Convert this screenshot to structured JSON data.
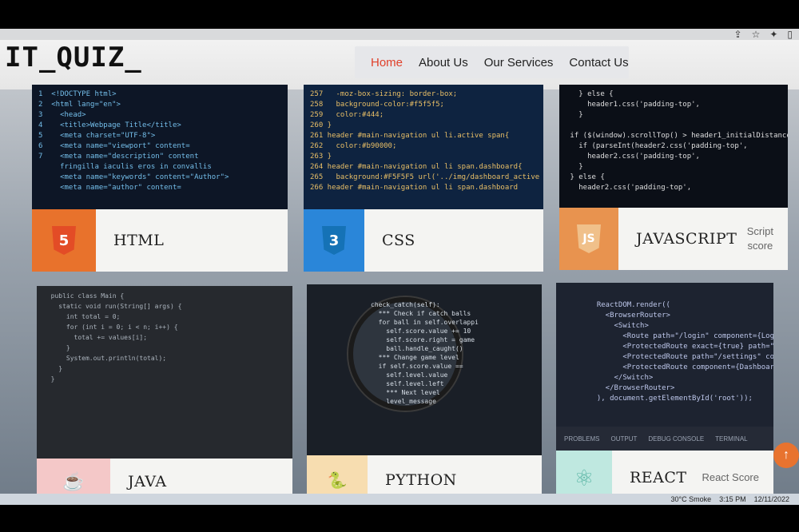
{
  "site": {
    "logo": "IT_QUIZ_"
  },
  "nav": [
    {
      "label": "Home",
      "active": true
    },
    {
      "label": "About Us",
      "active": false
    },
    {
      "label": "Our Services",
      "active": false
    },
    {
      "label": "Contact Us",
      "active": false
    }
  ],
  "cards": [
    {
      "title": "HTML",
      "icon": "html5-icon",
      "icon_text": "5",
      "badge_color": "#e8722c",
      "shield_color": "#e34c26",
      "score": ""
    },
    {
      "title": "CSS",
      "icon": "css3-icon",
      "icon_text": "3",
      "badge_color": "#2a86d9",
      "shield_color": "#1572b6",
      "score": ""
    },
    {
      "title": "JAVASCRIPT",
      "icon": "js-icon",
      "icon_text": "JS",
      "badge_color": "#e8934f",
      "shield_color": "#f0c08a",
      "score": "Script\nscore"
    },
    {
      "title": "JAVA",
      "icon": "java-cup-icon",
      "icon_text": "☕",
      "badge_color": "#f4c8c8",
      "shield_color": "",
      "score": ""
    },
    {
      "title": "PYTHON",
      "icon": "python-icon",
      "icon_text": "🐍",
      "badge_color": "#f7ddb0",
      "shield_color": "",
      "score": ""
    },
    {
      "title": "REACT",
      "icon": "react-atom-icon",
      "icon_text": "⚛",
      "badge_color": "#bfe8e0",
      "shield_color": "",
      "score": "React Score"
    }
  ],
  "code_snippets": {
    "html": "1  <!DOCTYPE html>\n2  <html lang=\"en\">\n3    <head>\n4    <title>Webpage Title</title>\n5    <meta charset=\"UTF-8\">\n6    <meta name=\"viewport\" content=\n7    <meta name=\"description\" content\n     fringilla iaculis eros in convallis\n     <meta name=\"keywords\" content=\"Author\">\n     <meta name=\"author\" content=",
    "css": "257   -moz-box-sizing: border-box;\n258   background-color:#f5f5f5;\n259   color:#444;\n260 }\n261 header #main-navigation ul li.active span{\n262   color:#b90000;\n263 }\n264 header #main-navigation ul li span.dashboard{\n265   background:#F5F5F5 url('../img/dashboard_active\n266 header #main-navigation ul li span.dashboard",
    "js": "   } else {\n     header1.css('padding-top',\n   }\n\n if ($(window).scrollTop() > header1_initialDistance\n   if (parseInt(header2.css('padding-top',\n     header2.css('padding-top',\n   }\n } else {\n   header2.css('padding-top',",
    "java": "  public class Main {\n    static void run(String[] args) {\n      int total = 0;\n      for (int i = 0; i < n; i++) {\n        total += values[i];\n      }\n      System.out.println(total);\n    }\n  }",
    "python": "check_catch(self):\n  *** Check if catch balls\n  for ball in self.overlappi\n    self.score.value += 10\n    self.score.right = game\n    ball.handle_caught()\n  *** Change game level\n  if self.score.value ==\n    self.level.value\n    self.level.left\n    *** Next level\n    level_message",
    "react": "  ReactDOM.render((\n    <BrowserRouter>\n      <Switch>\n        <Route path=\"/login\" component={Login}\n        <ProtectedRoute exact={true} path=\"/\"\n        <ProtectedRoute path=\"/settings\" component\n        <ProtectedRoute component={Dashboard}\n      </Switch>\n    </BrowserRouter>\n  ), document.getElementById('root'));"
  },
  "react_panel_tabs": [
    "PROBLEMS",
    "OUTPUT",
    "DEBUG CONSOLE",
    "TERMINAL"
  ],
  "taskbar": {
    "weather": "30°C  Smoke",
    "time": "3:15 PM",
    "date": "12/11/2022"
  },
  "scroll_top_icon": "arrow-up-icon"
}
